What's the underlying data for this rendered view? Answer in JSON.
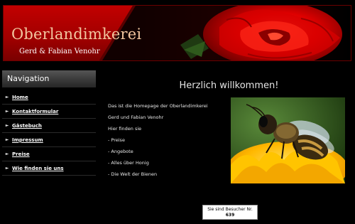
{
  "header": {
    "title": "Oberlandimkerei",
    "subtitle": "Gerd & Fabian Venohr"
  },
  "navigation": {
    "heading": "Navigation",
    "items": [
      {
        "label": "Home",
        "icon": "arrow-bullet-icon"
      },
      {
        "label": "Kontaktformular",
        "icon": "arrow-bullet-icon"
      },
      {
        "label": "Gästebuch",
        "icon": "arrow-bullet-icon"
      },
      {
        "label": "Impressum",
        "icon": "arrow-bullet-icon"
      },
      {
        "label": "Preise",
        "icon": "arrow-bullet-icon"
      },
      {
        "label": "Wie finden sie uns",
        "icon": "arrow-bullet-icon"
      }
    ]
  },
  "main": {
    "welcome": "Herzlich willkommen!",
    "intro": "Das ist die Homepage der Oberlandimkerei",
    "owners": "Gerd und Fabian Venohr",
    "find_here": "Hier finden sie",
    "list": [
      "- Preise",
      "- Angebote",
      "- Alles über Honig",
      "- Die Welt der Bienen"
    ]
  },
  "counter": {
    "label": "Sie sind Besucher Nr.",
    "number": "639"
  },
  "colors": {
    "header_red": "#c20000",
    "title_color": "#f2c7a0",
    "background": "#000000"
  }
}
